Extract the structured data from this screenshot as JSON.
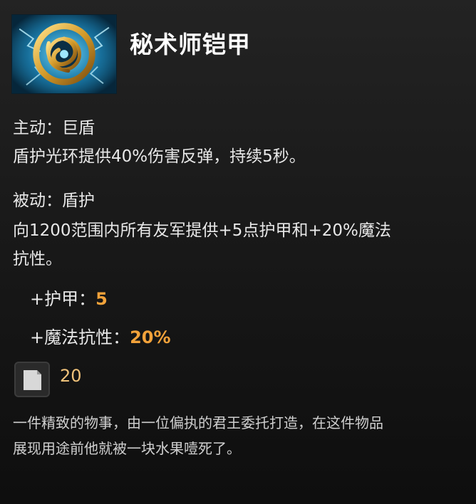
{
  "item": {
    "name": "秘术师铠甲",
    "icon": "arcane-shield-amulet-icon"
  },
  "active": {
    "header": "主动：巨盾",
    "desc": "盾护光环提供40%伤害反弹，持续5秒。"
  },
  "passive": {
    "header": "被动：盾护",
    "desc_line1": "向1200范围内所有友军提供+5点护甲和+20%魔法",
    "desc_line2": "抗性。"
  },
  "stats": [
    {
      "label": "+护甲：",
      "value": "5"
    },
    {
      "label": "+魔法抗性：",
      "value": "20%"
    }
  ],
  "cost": {
    "icon": "cooldown-manacost-icon",
    "value": "20"
  },
  "lore": {
    "line1": "一件精致的物事，由一位偏执的君王委托打造，在这件物品",
    "line2": "展现用途前他就被一块水果噎死了。"
  },
  "colors": {
    "background": "#1a1a1a",
    "stat_value": "#f2a23a",
    "title": "#ffffff"
  }
}
